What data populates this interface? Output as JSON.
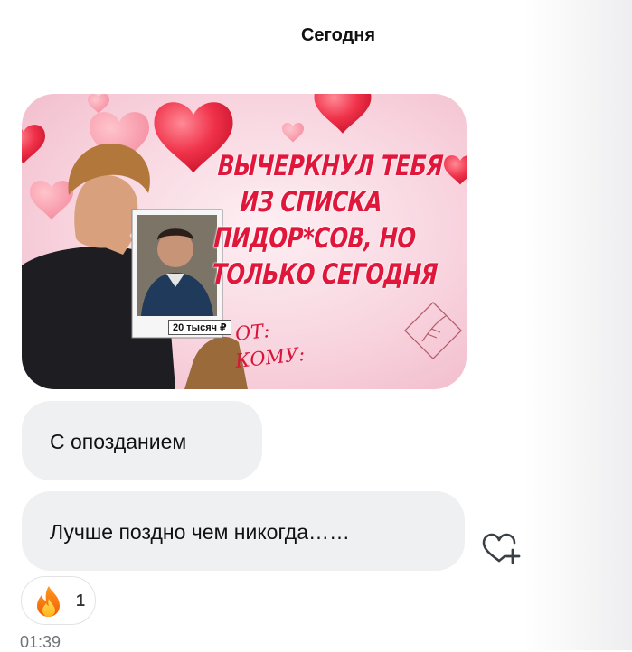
{
  "date_separator": "Сегодня",
  "sticker": {
    "headline_lines": [
      "ВЫЧЕРКНУЛ ТЕБЯ",
      "ИЗ СПИСКА",
      "ПИДОР*СОВ, НО",
      "ТОЛЬКО СЕГОДНЯ"
    ],
    "from_label": "ОТ:",
    "to_label": "КОМУ:",
    "photo_price": "20 тысяч ₽"
  },
  "messages": [
    {
      "text": "С опозданием"
    },
    {
      "text": "Лучше поздно чем никогда……"
    }
  ],
  "reaction": {
    "emoji": "fire-icon",
    "count": "1"
  },
  "timestamp": "01:39",
  "colors": {
    "bubble": "#eef0f2",
    "headline": "#e0163b",
    "heart": "#f23a4f",
    "timestamp": "#6f7479"
  }
}
